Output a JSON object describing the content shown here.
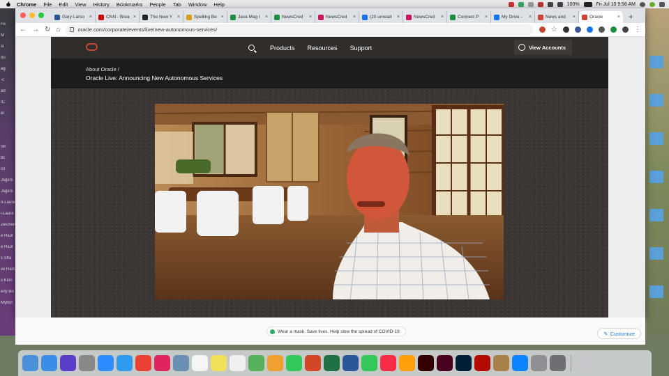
{
  "menubar": {
    "app": "Chrome",
    "items": [
      "File",
      "Edit",
      "View",
      "History",
      "Bookmarks",
      "People",
      "Tab",
      "Window",
      "Help"
    ],
    "battery": "100%",
    "clock": "Fri Jul 10  9:56 AM"
  },
  "tabs": [
    {
      "title": "Gary Larso",
      "color": "#2b5797"
    },
    {
      "title": "CNN - Brea",
      "color": "#cc0000"
    },
    {
      "title": "The New Y",
      "color": "#222222"
    },
    {
      "title": "Spelling Be",
      "color": "#d4a017"
    },
    {
      "title": "Java Mag I",
      "color": "#1e8e3e"
    },
    {
      "title": "NewsCred",
      "color": "#1e8e3e"
    },
    {
      "title": "NewsCred",
      "color": "#c2185b"
    },
    {
      "title": "(20 unread",
      "color": "#1a73e8"
    },
    {
      "title": "NewsCred",
      "color": "#c2185b"
    },
    {
      "title": "Connect P",
      "color": "#1e8e3e"
    },
    {
      "title": "My Drive -",
      "color": "#1a73e8"
    },
    {
      "title": "News and",
      "color": "#c74634"
    },
    {
      "title": "Oracle",
      "color": "#c74634",
      "active": true
    }
  ],
  "address": "oracle.com/corporate/events/live/new-autonomous-services/",
  "site": {
    "nav": [
      "Products",
      "Resources",
      "Support"
    ],
    "account": "View Accounts",
    "breadcrumb": "About Oracle  /",
    "title": "Oracle Live: Announcing New Autonomous Services"
  },
  "ntp": {
    "message": "Wear a mask. Save lives. Help slow the spread of COVID-19",
    "customize": "Customize"
  },
  "dock_apps": [
    "Finder",
    "Safari",
    "Siri",
    "Launchpad",
    "Zoom",
    "Safari",
    "Chrome",
    "Slack",
    "Preview",
    "Calendar",
    "Notes",
    "Reminders",
    "Maps",
    "Photos",
    "Messages",
    "PowerPoint",
    "Excel",
    "Word",
    "FaceTime",
    "Music",
    "Books",
    "Illustrator",
    "InDesign",
    "Photoshop",
    "Acrobat",
    "Script",
    "App Store",
    "System Preferences",
    "Utility",
    "Trash"
  ],
  "desktop_left": [
    "Fe",
    "M",
    "sl",
    "ou",
    "ag",
    "-c",
    "ad",
    "IC",
    "el",
    "",
    "",
    "Sh",
    "bc",
    "Gi",
    "Jsgers",
    "Jsgers",
    "n-Laure",
    "i-Laure",
    "Zeichen",
    "e Hauf",
    "e Hauf",
    "s Sha",
    "ve Ham",
    "s Kinn",
    "erly Bo",
    "MyBot"
  ]
}
